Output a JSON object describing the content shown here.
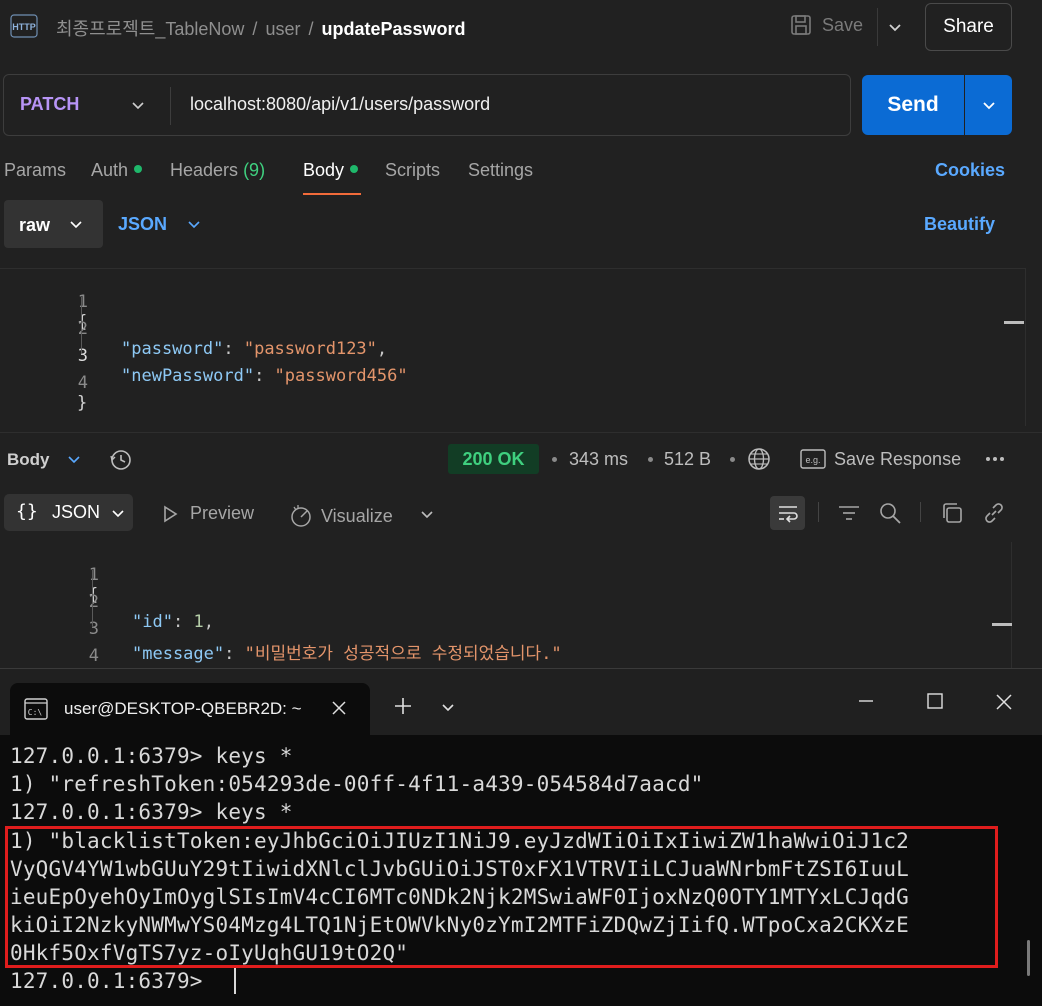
{
  "header": {
    "icon_label": "HTTP",
    "breadcrumb_collection": "최종프로젝트_TableNow",
    "breadcrumb_folder": "user",
    "breadcrumb_request": "updatePassword",
    "save_label": "Save",
    "share_label": "Share"
  },
  "request": {
    "method": "PATCH",
    "url": "localhost:8080/api/v1/users/password",
    "send_label": "Send"
  },
  "tabs": {
    "params": "Params",
    "auth": "Auth",
    "headers": "Headers",
    "headers_count": "(9)",
    "body": "Body",
    "scripts": "Scripts",
    "settings": "Settings",
    "cookies": "Cookies"
  },
  "body_options": {
    "mode": "raw",
    "format": "JSON",
    "beautify": "Beautify"
  },
  "request_body": {
    "line_numbers": [
      "1",
      "2",
      "3",
      "4"
    ],
    "open_brace": "{",
    "close_brace": "}",
    "key1": "\"password\"",
    "val1": "\"password123\"",
    "key2": "\"newPassword\"",
    "val2": "\"password456\""
  },
  "response": {
    "body_label": "Body",
    "status": "200 OK",
    "time": "343 ms",
    "size": "512 B",
    "save_response": "Save Response",
    "format": "JSON",
    "preview": "Preview",
    "visualize": "Visualize",
    "line_numbers": [
      "1",
      "2",
      "3",
      "4"
    ],
    "open_brace": "{",
    "close_brace": "}",
    "key1": "\"id\"",
    "val1": "1",
    "key2": "\"message\"",
    "val2": "\"비밀번호가 성공적으로 수정되었습니다.\""
  },
  "terminal": {
    "tab_title": "user@DESKTOP-QBEBR2D: ~",
    "lines": [
      "127.0.0.1:6379> keys *",
      "1) \"refreshToken:054293de-00ff-4f11-a439-054584d7aacd\"",
      "127.0.0.1:6379> keys *",
      "1) \"blacklistToken:eyJhbGciOiJIUzI1NiJ9.eyJzdWIiOiIxIiwiZW1haWwiOiJ1c2",
      "VyQGV4YW1wbGUuY29tIiwidXNlclJvbGUiOiJST0xFX1VTRVIiLCJuaWNrbmFtZSI6IuuL",
      "ieuEpOyehOyImOyglSIsImV4cCI6MTc0NDk2Njk2MSwiaWF0IjoxNzQ0OTY1MTYxLCJqdG",
      "kiOiI2NzkyNWMwYS04Mzg4LTQ1NjEtOWVkNy0zYmI2MTFiZDQwZjIifQ.WTpoCxa2CKXzE",
      "0Hkf5OxfVgTS7yz-oIyUqhGU19tO2Q\"",
      "127.0.0.1:6379> "
    ]
  },
  "colors": {
    "accent_blue": "#0b6bd4",
    "method_purple": "#b794f6",
    "status_green": "#3fd07f",
    "highlight_red": "#e01d1d",
    "tab_underline": "#f26b3a"
  }
}
